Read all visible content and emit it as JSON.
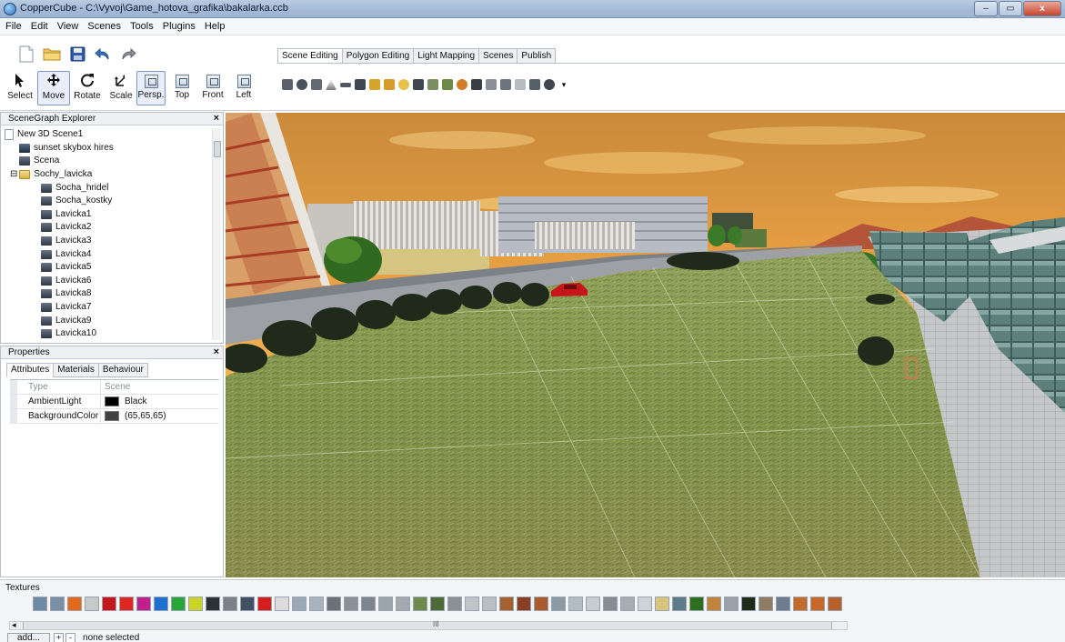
{
  "window": {
    "title": "CopperCube - C:\\Vyvoj\\Game_hotova_grafika\\bakalarka.ccb",
    "controls": [
      "–",
      "▭",
      "x"
    ]
  },
  "menu": [
    "File",
    "Edit",
    "View",
    "Scenes",
    "Tools",
    "Plugins",
    "Help"
  ],
  "toolbar": {
    "tools": [
      {
        "label": "Select",
        "icon": "arrow-pointer-icon",
        "active": false
      },
      {
        "label": "Move",
        "icon": "move-arrows-icon",
        "active": true
      },
      {
        "label": "Rotate",
        "icon": "rotate-icon",
        "active": false
      },
      {
        "label": "Scale",
        "icon": "scale-icon",
        "active": false
      }
    ],
    "views": [
      {
        "label": "Persp.",
        "active": true
      },
      {
        "label": "Top",
        "active": false
      },
      {
        "label": "Front",
        "active": false
      },
      {
        "label": "Left",
        "active": false
      }
    ],
    "tabs": [
      "Scene Editing",
      "Polygon Editing",
      "Light Mapping",
      "Scenes",
      "Publish"
    ],
    "active_tab": "Scene Editing"
  },
  "scenegraph": {
    "title": "SceneGraph Explorer",
    "close": "×",
    "nodes": [
      {
        "label": "New 3D Scene1",
        "indent": 0,
        "kind": "scene"
      },
      {
        "label": "sunset skybox hires",
        "indent": 1,
        "kind": "sky"
      },
      {
        "label": "Scena",
        "indent": 1,
        "kind": "mesh"
      },
      {
        "label": "Sochy_lavicka",
        "indent": 1,
        "kind": "folder"
      },
      {
        "label": "Socha_hridel",
        "indent": 2,
        "kind": "mesh"
      },
      {
        "label": "Socha_kostky",
        "indent": 2,
        "kind": "mesh"
      },
      {
        "label": "Lavicka1",
        "indent": 2,
        "kind": "mesh"
      },
      {
        "label": "Lavicka2",
        "indent": 2,
        "kind": "mesh"
      },
      {
        "label": "Lavicka3",
        "indent": 2,
        "kind": "mesh"
      },
      {
        "label": "Lavicka4",
        "indent": 2,
        "kind": "mesh"
      },
      {
        "label": "Lavicka5",
        "indent": 2,
        "kind": "mesh"
      },
      {
        "label": "Lavicka6",
        "indent": 2,
        "kind": "mesh"
      },
      {
        "label": "Lavicka8",
        "indent": 2,
        "kind": "mesh"
      },
      {
        "label": "Lavicka7",
        "indent": 2,
        "kind": "mesh"
      },
      {
        "label": "Lavicka9",
        "indent": 2,
        "kind": "mesh"
      },
      {
        "label": "Lavicka10",
        "indent": 2,
        "kind": "mesh"
      }
    ]
  },
  "properties": {
    "title": "Properties",
    "close": "×",
    "tabs": [
      "Attributes",
      "Materials",
      "Behaviour"
    ],
    "active_tab": "Attributes",
    "header": {
      "key": "Type",
      "value": "Scene"
    },
    "rows": [
      {
        "key": "AmbientLight",
        "value": "Black",
        "color": "#000000"
      },
      {
        "key": "BackgroundColor",
        "value": "(65,65,65)",
        "color": "#414141"
      }
    ]
  },
  "textures": {
    "label": "Textures",
    "add_label": "add...",
    "plus": "+",
    "minus": "-",
    "status": "none selected",
    "scroll_grip": "III",
    "swatches": [
      "#6f8aa3",
      "#7b8fa6",
      "#e06a1a",
      "#c8c8c8",
      "#c4161c",
      "#e0271f",
      "#c0208c",
      "#1f6fd1",
      "#29a63a",
      "#c9d42a",
      "#2d3137",
      "#7c8088",
      "#3f4f66",
      "#d51d1d",
      "#dcdcdc",
      "#9aa7b5",
      "#a9b3bf",
      "#6b7179",
      "#8b9096",
      "#7d858e",
      "#9ca4ad",
      "#a2a9b1",
      "#6e8a4c",
      "#4d6a3a",
      "#8c8f93",
      "#bfc4c9",
      "#b9bec4",
      "#a2612f",
      "#8a4022",
      "#a95a2f",
      "#8b9aa3",
      "#b4bdc6",
      "#c8ccd1",
      "#868d95",
      "#a6acb4",
      "#cfd4d9",
      "#d8c67f",
      "#5d7a8b",
      "#2f6d1f",
      "#c2843a",
      "#9aa1a8",
      "#1e2a1a",
      "#8f7b62",
      "#6d7d91",
      "#c46a2b",
      "#c7682a",
      "#b85e28"
    ]
  }
}
